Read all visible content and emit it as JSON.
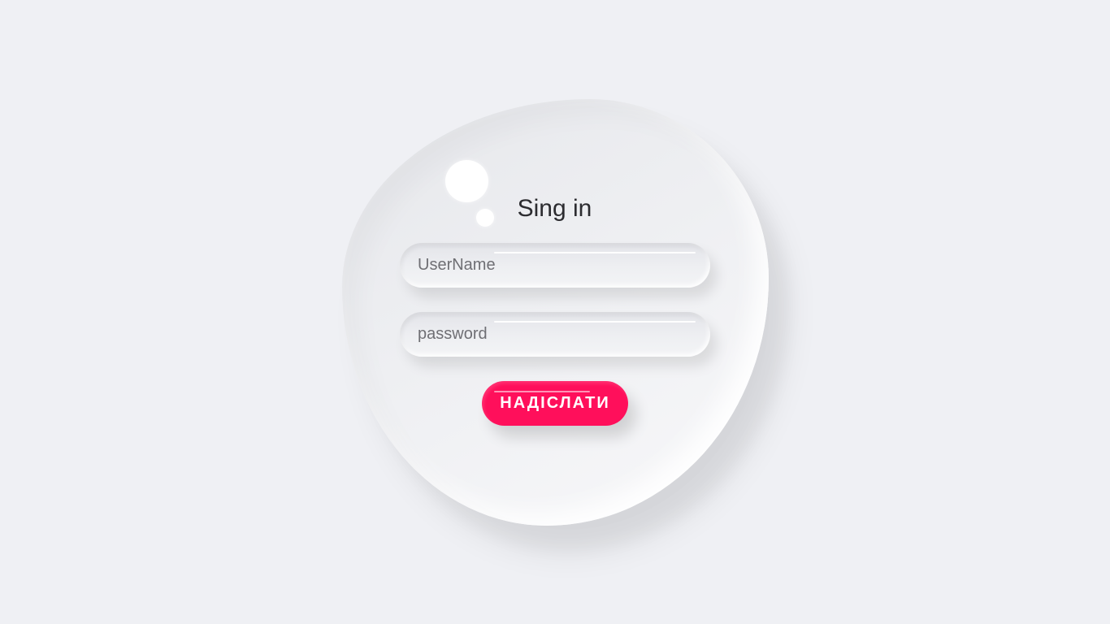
{
  "login_form": {
    "title": "Sing in",
    "username": {
      "value": "",
      "placeholder": "UserName"
    },
    "password": {
      "value": "",
      "placeholder": "password"
    },
    "submit_label": "НАДІСЛАТИ"
  },
  "colors": {
    "background": "#eff0f4",
    "accent": "#ff0f5b",
    "title_text": "#2c2c30",
    "placeholder_text": "#6f6f74"
  }
}
